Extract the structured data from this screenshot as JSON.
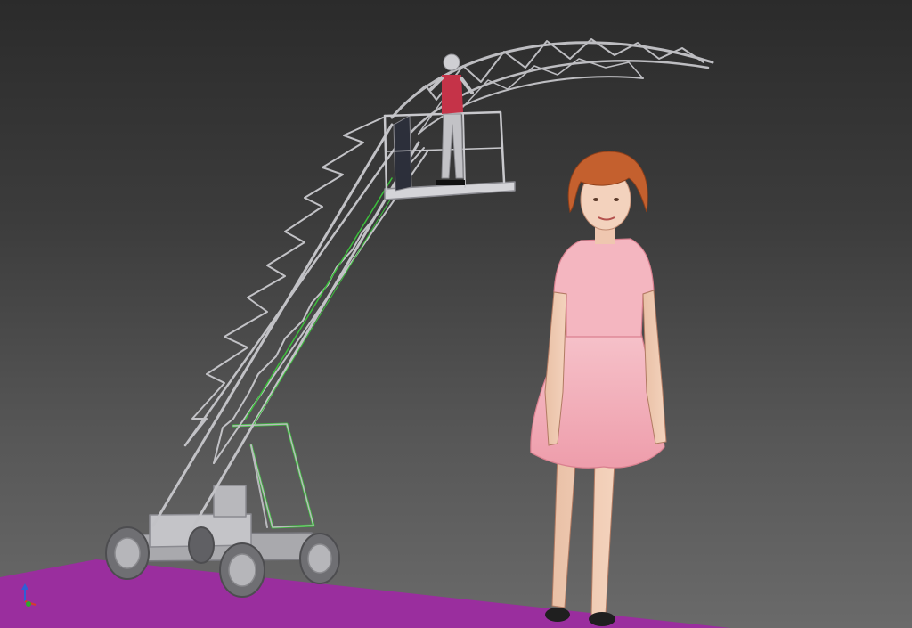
{
  "scene": {
    "background_top": "#2b2b2b",
    "background_bottom": "#6a6a6a",
    "floor_color": "#9a2e9e",
    "crane_color": "#b9b9bd",
    "highlight_color": "#3cbf3c",
    "dress_color": "#f1a8b4",
    "hair_color": "#c4602e"
  },
  "axis_gizmo": {
    "x_color": "#d83a2c",
    "y_color": "#2ea82e",
    "z_color": "#2f5fd6",
    "icon": "axis-triad-icon"
  }
}
